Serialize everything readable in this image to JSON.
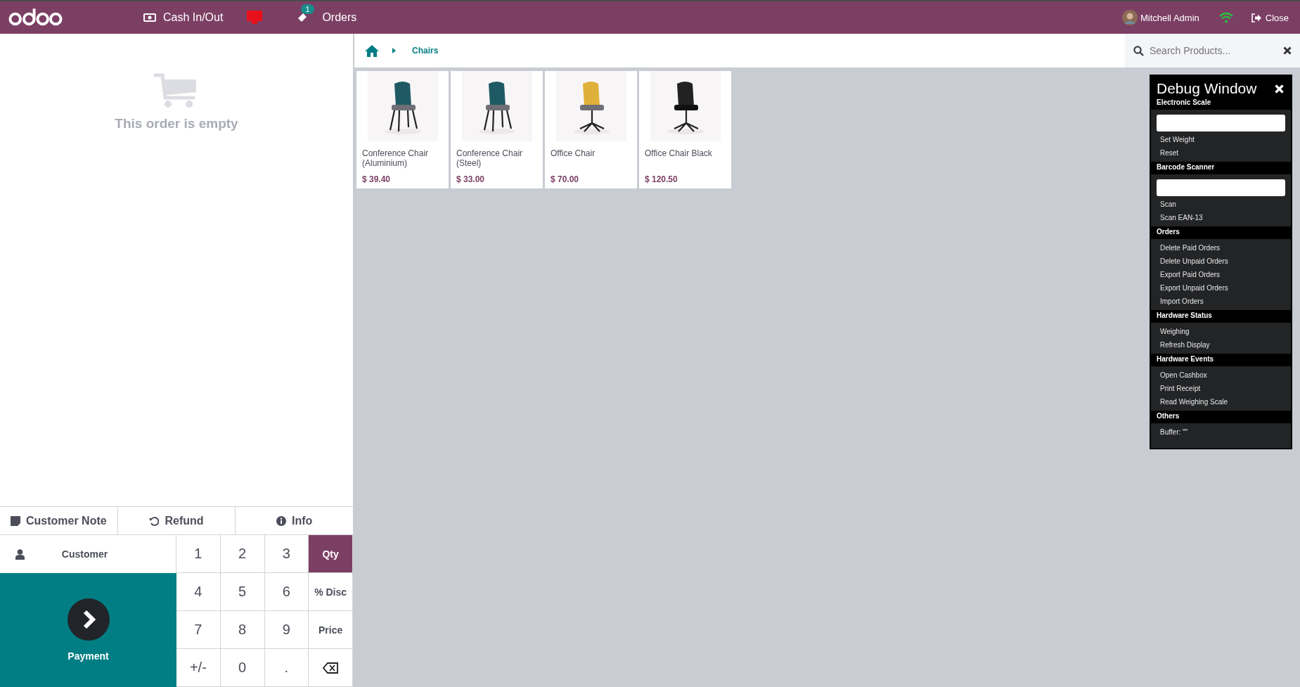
{
  "header": {
    "cash_button": "Cash In/Out",
    "orders_button": "Orders",
    "orders_badge": "1",
    "user": "Mitchell Admin",
    "close_button": "Close"
  },
  "order": {
    "empty_message": "This order is empty"
  },
  "control_buttons": [
    {
      "kind": "note",
      "label": "Customer Note"
    },
    {
      "kind": "refund",
      "label": "Refund"
    },
    {
      "kind": "info",
      "label": "Info"
    }
  ],
  "customer_button": "Customer",
  "payment_button": "Payment",
  "numpad": [
    {
      "kind": "key",
      "label": "1"
    },
    {
      "kind": "key",
      "label": "2"
    },
    {
      "kind": "key",
      "label": "3"
    },
    {
      "kind": "mode",
      "label": "Qty",
      "selected": true
    },
    {
      "kind": "key",
      "label": "4"
    },
    {
      "kind": "key",
      "label": "5"
    },
    {
      "kind": "key",
      "label": "6"
    },
    {
      "kind": "mode",
      "label": "% Disc",
      "selected": false
    },
    {
      "kind": "key",
      "label": "7"
    },
    {
      "kind": "key",
      "label": "8"
    },
    {
      "kind": "key",
      "label": "9"
    },
    {
      "kind": "mode",
      "label": "Price",
      "selected": false
    },
    {
      "kind": "key",
      "label": "+/-"
    },
    {
      "kind": "key",
      "label": "0"
    },
    {
      "kind": "key",
      "label": "."
    },
    {
      "kind": "backspace"
    }
  ],
  "breadcrumb": {
    "current": "Chairs"
  },
  "search": {
    "placeholder": "Search Products..."
  },
  "products": [
    {
      "name": "Conference Chair (Aluminium)",
      "price": "$ 39.40"
    },
    {
      "name": "Conference Chair (Steel)",
      "price": "$ 33.00"
    },
    {
      "name": "Office Chair",
      "price": "$ 70.00"
    },
    {
      "name": "Office Chair Black",
      "price": "$ 120.50"
    }
  ],
  "debug_window": {
    "title": "Debug Window",
    "sections": [
      {
        "title": "Electronic Scale",
        "items": [
          {
            "kind": "input"
          },
          {
            "kind": "action",
            "label": "Set Weight"
          },
          {
            "kind": "action",
            "label": "Reset"
          }
        ]
      },
      {
        "title": "Barcode Scanner",
        "items": [
          {
            "kind": "input"
          },
          {
            "kind": "action",
            "label": "Scan"
          },
          {
            "kind": "action",
            "label": "Scan EAN-13"
          }
        ]
      },
      {
        "title": "Orders",
        "items": [
          {
            "kind": "action",
            "label": "Delete Paid Orders"
          },
          {
            "kind": "action",
            "label": "Delete Unpaid Orders"
          },
          {
            "kind": "action",
            "label": "Export Paid Orders"
          },
          {
            "kind": "action",
            "label": "Export Unpaid Orders"
          },
          {
            "kind": "action",
            "label": "Import Orders"
          }
        ]
      },
      {
        "title": "Hardware Status",
        "items": [
          {
            "kind": "action",
            "label": "Weighing"
          },
          {
            "kind": "action",
            "label": "Refresh Display"
          }
        ]
      },
      {
        "title": "Hardware Events",
        "items": [
          {
            "kind": "action",
            "label": "Open Cashbox"
          },
          {
            "kind": "action",
            "label": "Print Receipt"
          },
          {
            "kind": "action",
            "label": "Read Weighing Scale"
          }
        ]
      },
      {
        "title": "Others",
        "items": [
          {
            "kind": "text",
            "label": "Buffer: \"\""
          }
        ]
      }
    ]
  }
}
